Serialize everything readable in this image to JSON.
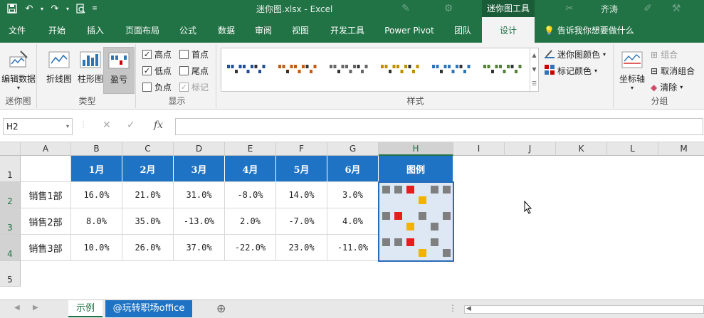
{
  "window": {
    "title": "迷你图.xlsx  -  Excel",
    "context_tab": "迷你图工具",
    "user": "齐涛"
  },
  "tabs": [
    "文件",
    "开始",
    "插入",
    "页面布局",
    "公式",
    "数据",
    "审阅",
    "视图",
    "开发工具",
    "Power Pivot",
    "团队",
    "设计"
  ],
  "tell_me": "告诉我你想要做什么",
  "ribbon": {
    "sparkline_group": {
      "edit": "编辑数据",
      "label": "迷你图"
    },
    "type_group": {
      "line": "折线图",
      "column": "柱形图",
      "winloss": "盈亏",
      "label": "类型"
    },
    "show_group": {
      "label": "显示",
      "items": [
        {
          "label": "高点",
          "checked": true
        },
        {
          "label": "首点",
          "checked": false
        },
        {
          "label": "低点",
          "checked": true
        },
        {
          "label": "尾点",
          "checked": false
        },
        {
          "label": "负点",
          "checked": false
        },
        {
          "label": "标记",
          "checked": true,
          "disabled": true
        }
      ]
    },
    "style_group": {
      "label": "样式",
      "sparkline_color": "迷你图颜色",
      "marker_color": "标记颜色",
      "swatch_colors": [
        "#1f4e9a",
        "#c55a11",
        "#666666",
        "#bf8f00",
        "#2e75b6",
        "#548235"
      ]
    },
    "group_group": {
      "axis": "坐标轴",
      "group": "组合",
      "ungroup": "取消组合",
      "clear": "清除",
      "label": "分组"
    }
  },
  "formula_bar": {
    "name_box": "H2",
    "fx": "fx",
    "value": ""
  },
  "columns": [
    "A",
    "B",
    "C",
    "D",
    "E",
    "F",
    "G",
    "H",
    "I",
    "J",
    "K",
    "L",
    "M"
  ],
  "rows": [
    "1",
    "2",
    "3",
    "4",
    "5"
  ],
  "table": {
    "headers": [
      "1月",
      "2月",
      "3月",
      "4月",
      "5月",
      "6月",
      "图例"
    ],
    "rows": [
      {
        "label": "销售1部",
        "values": [
          "16.0%",
          "21.0%",
          "31.0%",
          "-8.0%",
          "14.0%",
          "3.0%"
        ],
        "winloss": [
          16,
          21,
          31,
          -8,
          14,
          3
        ],
        "high": 2,
        "low": 3
      },
      {
        "label": "销售2部",
        "values": [
          "8.0%",
          "35.0%",
          "-13.0%",
          "2.0%",
          "-7.0%",
          "4.0%"
        ],
        "winloss": [
          8,
          35,
          -13,
          2,
          -7,
          4
        ],
        "high": 1,
        "low": 2
      },
      {
        "label": "销售3部",
        "values": [
          "10.0%",
          "26.0%",
          "37.0%",
          "-22.0%",
          "23.0%",
          "-11.0%"
        ],
        "winloss": [
          10,
          26,
          37,
          -22,
          23,
          -11
        ],
        "high": 2,
        "low": 3
      }
    ]
  },
  "colors": {
    "header_bg": "#1f73c4",
    "positive": "#7f7f7f",
    "high": "#e81c1c",
    "low": "#f0b400",
    "accent": "#217346"
  },
  "sheets": [
    "示例",
    "@玩转职场office"
  ]
}
